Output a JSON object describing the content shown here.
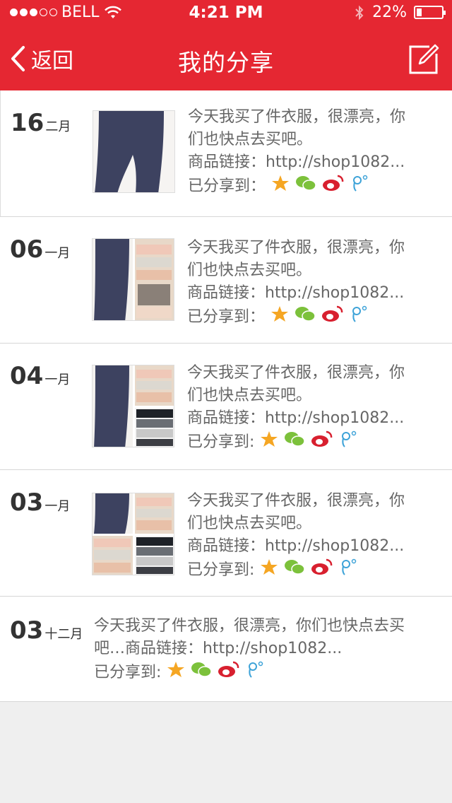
{
  "status": {
    "carrier": "BELL",
    "time": "4:21 PM",
    "battery": "22%",
    "battery_level": 0.22
  },
  "nav": {
    "back_label": "返回",
    "title": "我的分享"
  },
  "colors": {
    "brand": "#e52732",
    "star": "#f5a623",
    "wechat": "#7cc13b",
    "weibo": "#d8202f",
    "tencent": "#3ea3d8"
  },
  "items": [
    {
      "day": "16",
      "month": "二月",
      "line1": "今天我买了件衣服，很漂亮，你",
      "line2": "们也快点去买吧。",
      "line3": "商品链接：http://shop1082...",
      "shared_label": "已分享到：",
      "images": 1
    },
    {
      "day": "06",
      "month": "一月",
      "line1": "今天我买了件衣服，很漂亮，你",
      "line2": "们也快点去买吧。",
      "line3": "商品链接：http://shop1082...",
      "shared_label": "已分享到：",
      "images": 2
    },
    {
      "day": "04",
      "month": "一月",
      "line1": "今天我买了件衣服，很漂亮，你",
      "line2": "们也快点去买吧。",
      "line3": "商品链接：http://shop1082...",
      "shared_label": "已分享到:",
      "images": 3
    },
    {
      "day": "03",
      "month": "一月",
      "line1": "今天我买了件衣服，很漂亮，你",
      "line2": "们也快点去买吧。",
      "line3": "商品链接：http://shop1082...",
      "shared_label": "已分享到:",
      "images": 4
    },
    {
      "day": "03",
      "month": "十二月",
      "line1": "今天我买了件衣服，很漂亮，你们也快点去买",
      "line2": "吧…商品链接：http://shop1082...",
      "shared_label": "已分享到:",
      "images": 0
    }
  ],
  "share_icons": [
    "qzone-star-icon",
    "wechat-icon",
    "weibo-icon",
    "tencent-weibo-icon"
  ]
}
